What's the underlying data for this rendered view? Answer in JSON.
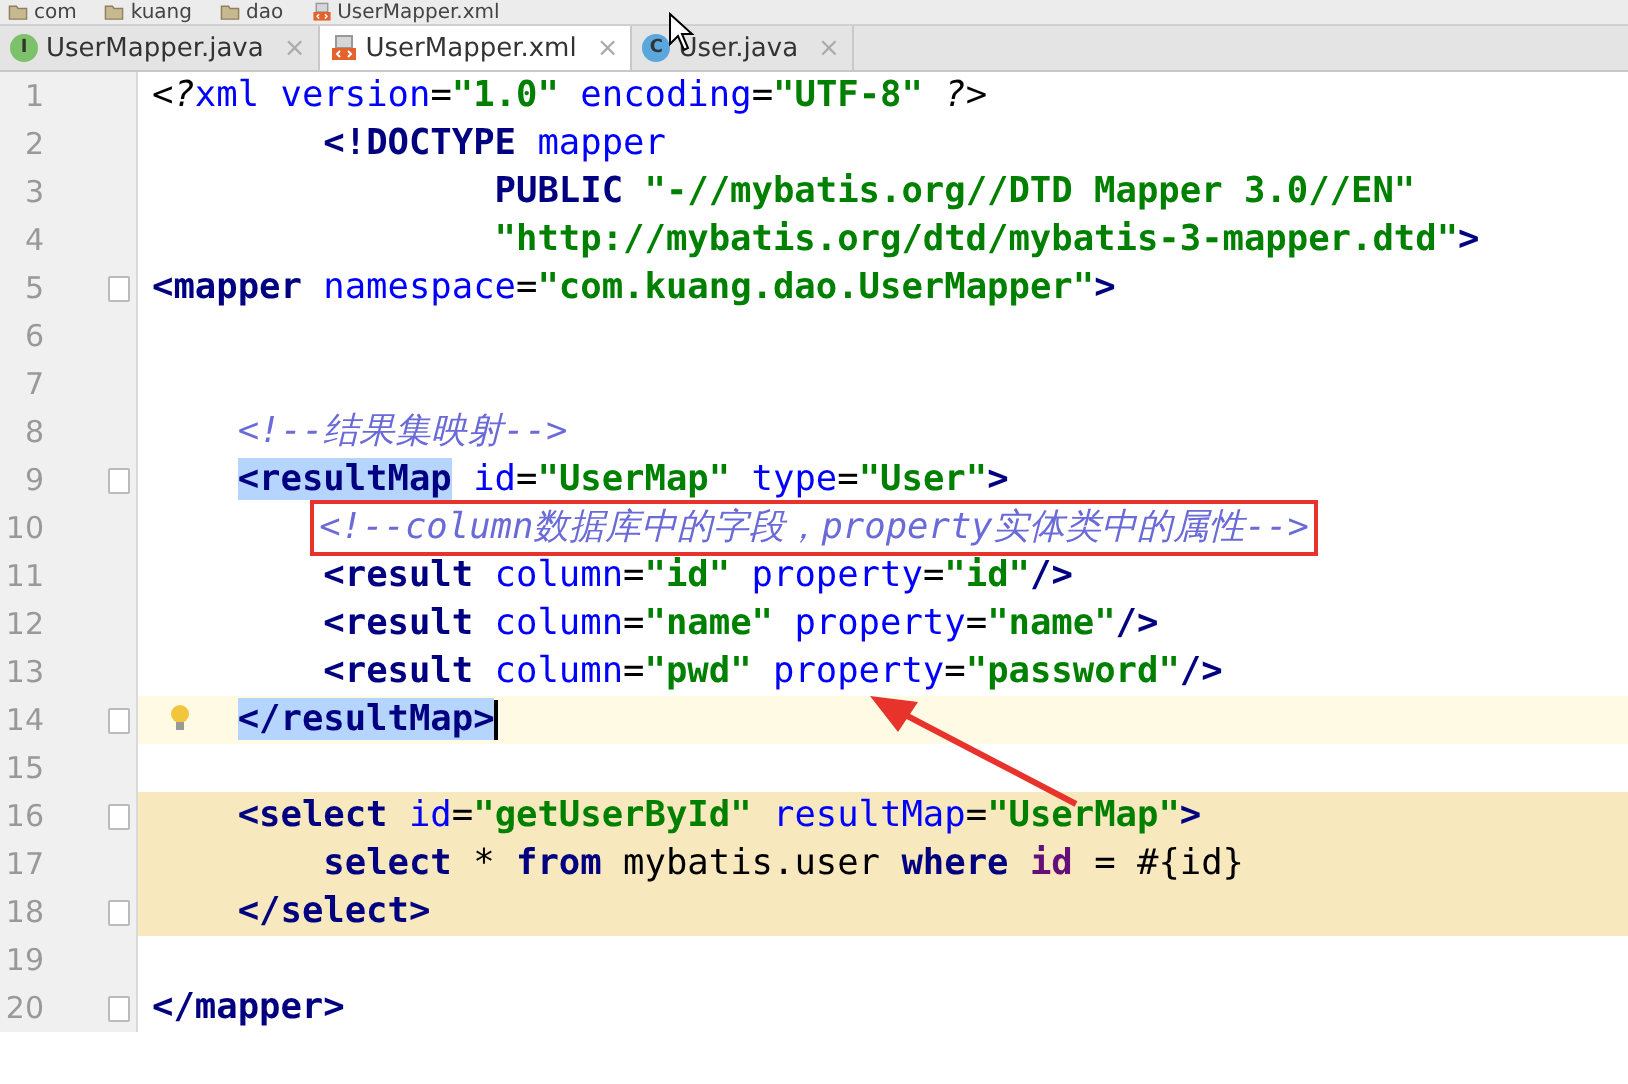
{
  "breadcrumbs": [
    {
      "label": "com",
      "kind": "folder"
    },
    {
      "label": "kuang",
      "kind": "folder"
    },
    {
      "label": "dao",
      "kind": "folder"
    },
    {
      "label": "UserMapper.xml",
      "kind": "xml"
    }
  ],
  "tabs": [
    {
      "label": "UserMapper.java",
      "kind": "interface",
      "letter": "I",
      "close": "×",
      "selected": false
    },
    {
      "label": "UserMapper.xml",
      "kind": "xml",
      "close": "×",
      "selected": true
    },
    {
      "label": "User.java",
      "kind": "class",
      "letter": "C",
      "close": "×",
      "selected": false
    }
  ],
  "editor": {
    "lines": [
      {
        "n": "1",
        "tokens": [
          {
            "kind": "pi",
            "text": "<?"
          },
          {
            "kind": "attr",
            "text": "xml"
          },
          {
            "kind": "attr",
            "text": " version"
          },
          {
            "kind": "plain",
            "text": "="
          },
          {
            "kind": "str",
            "text": "\"1.0\""
          },
          {
            "kind": "attr",
            "text": " encoding"
          },
          {
            "kind": "plain",
            "text": "="
          },
          {
            "kind": "str",
            "text": "\"UTF-8\""
          },
          {
            "kind": "pi",
            "text": " ?>"
          }
        ]
      },
      {
        "n": "2",
        "tokens": [
          {
            "kind": "tag",
            "text": "        <!DOCTYPE"
          },
          {
            "kind": "attr",
            "text": " mapper"
          }
        ]
      },
      {
        "n": "3",
        "tokens": [
          {
            "kind": "tag",
            "text": "                PUBLIC"
          },
          {
            "kind": "str",
            "text": " \"-//mybatis.org//DTD Mapper 3.0//EN\""
          }
        ]
      },
      {
        "n": "4",
        "tokens": [
          {
            "kind": "str",
            "text": "                \"http://mybatis.org/dtd/mybatis-3-mapper.dtd\""
          },
          {
            "kind": "tag",
            "text": ">"
          }
        ]
      },
      {
        "n": "5",
        "fold": true,
        "tokens": [
          {
            "kind": "tag",
            "text": "<mapper"
          },
          {
            "kind": "attr",
            "text": " namespace"
          },
          {
            "kind": "plain",
            "text": "="
          },
          {
            "kind": "str",
            "text": "\"com.kuang.dao.UserMapper\""
          },
          {
            "kind": "tag",
            "text": ">"
          }
        ]
      },
      {
        "n": "6"
      },
      {
        "n": "7"
      },
      {
        "n": "8",
        "tokens": [
          {
            "kind": "comment",
            "text": "    <!--结果集映射-->"
          }
        ]
      },
      {
        "n": "9",
        "fold": true,
        "tokens": [
          {
            "kind": "tagmatch",
            "text": "    <resultMap"
          },
          {
            "kind": "attr",
            "text": " id"
          },
          {
            "kind": "plain",
            "text": "="
          },
          {
            "kind": "str",
            "text": "\"UserMap\""
          },
          {
            "kind": "attr",
            "text": " type"
          },
          {
            "kind": "plain",
            "text": "="
          },
          {
            "kind": "str",
            "text": "\"User\""
          },
          {
            "kind": "tag",
            "text": ">"
          }
        ]
      },
      {
        "n": "10",
        "boxed": true,
        "tokens": [
          {
            "kind": "comment",
            "text": "        <!--column数据库中的字段，property实体类中的属性-->"
          }
        ]
      },
      {
        "n": "11",
        "tokens": [
          {
            "kind": "tag",
            "text": "        <result"
          },
          {
            "kind": "attr",
            "text": " column"
          },
          {
            "kind": "plain",
            "text": "="
          },
          {
            "kind": "str",
            "text": "\"id\""
          },
          {
            "kind": "attr",
            "text": " property"
          },
          {
            "kind": "plain",
            "text": "="
          },
          {
            "kind": "str",
            "text": "\"id\""
          },
          {
            "kind": "tag",
            "text": "/>"
          }
        ]
      },
      {
        "n": "12",
        "tokens": [
          {
            "kind": "tag",
            "text": "        <result"
          },
          {
            "kind": "attr",
            "text": " column"
          },
          {
            "kind": "plain",
            "text": "="
          },
          {
            "kind": "str",
            "text": "\"name\""
          },
          {
            "kind": "attr",
            "text": " property"
          },
          {
            "kind": "plain",
            "text": "="
          },
          {
            "kind": "str",
            "text": "\"name\""
          },
          {
            "kind": "tag",
            "text": "/>"
          }
        ]
      },
      {
        "n": "13",
        "tokens": [
          {
            "kind": "tag",
            "text": "        <result"
          },
          {
            "kind": "attr",
            "text": " column"
          },
          {
            "kind": "plain",
            "text": "="
          },
          {
            "kind": "str",
            "text": "\"pwd\""
          },
          {
            "kind": "attr",
            "text": " property"
          },
          {
            "kind": "plain",
            "text": "="
          },
          {
            "kind": "str",
            "text": "\"password\""
          },
          {
            "kind": "tag",
            "text": "/>"
          }
        ]
      },
      {
        "n": "14",
        "fold": true,
        "bulb": true,
        "current": true,
        "caret": true,
        "tokens": [
          {
            "kind": "tagmatch",
            "text": "    </resultMap>"
          }
        ]
      },
      {
        "n": "15"
      },
      {
        "n": "16",
        "fold": true,
        "injected": true,
        "tokens": [
          {
            "kind": "tag",
            "text": "    <select"
          },
          {
            "kind": "attr",
            "text": " id"
          },
          {
            "kind": "plain",
            "text": "="
          },
          {
            "kind": "str",
            "text": "\"getUserById\""
          },
          {
            "kind": "attr",
            "text": " resultMap"
          },
          {
            "kind": "plain",
            "text": "="
          },
          {
            "kind": "str",
            "text": "\"UserMap\""
          },
          {
            "kind": "tag",
            "text": ">"
          }
        ]
      },
      {
        "n": "17",
        "injected": true,
        "tokens": [
          {
            "kind": "kw",
            "text": "        select"
          },
          {
            "kind": "text",
            "text": " * "
          },
          {
            "kind": "kw",
            "text": "from"
          },
          {
            "kind": "text",
            "text": " mybatis.user "
          },
          {
            "kind": "kw",
            "text": "where"
          },
          {
            "kind": "col",
            "text": " id"
          },
          {
            "kind": "text",
            "text": " = #{id}"
          }
        ]
      },
      {
        "n": "18",
        "fold": true,
        "injected": true,
        "tokens": [
          {
            "kind": "tag",
            "text": "    </select>"
          }
        ]
      },
      {
        "n": "19"
      },
      {
        "n": "20",
        "fold": true,
        "tokens": [
          {
            "kind": "tag",
            "text": "</mapper>"
          }
        ]
      }
    ]
  }
}
